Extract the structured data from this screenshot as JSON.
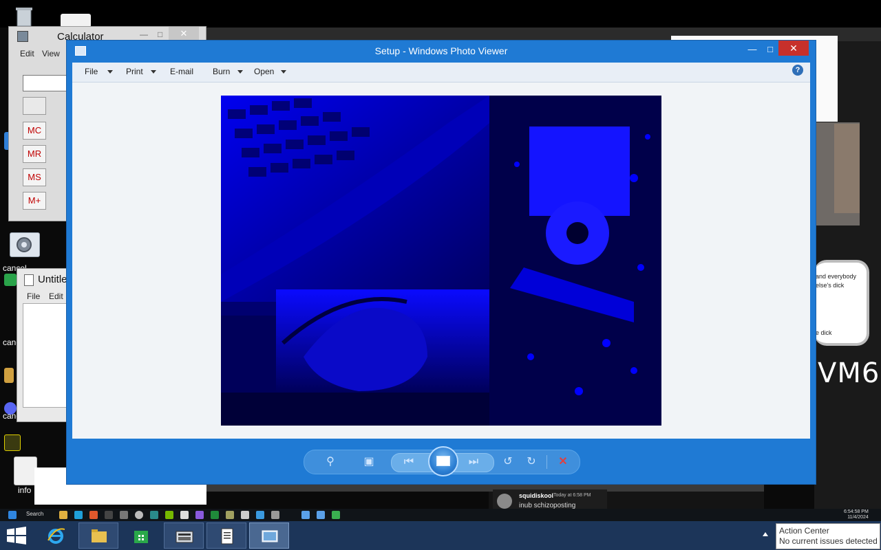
{
  "desktop": {
    "icon_labels": [
      "cancel",
      "cancel",
      "cancel",
      "cancel",
      "cancel",
      "info"
    ],
    "note": {
      "line1": "and everybody",
      "line2": "else's dick",
      "line3": "e dick"
    },
    "scribble": "VM6"
  },
  "calculator": {
    "title": "Calculator",
    "menu": [
      "Edit",
      "View"
    ],
    "memory_buttons": [
      "MC",
      "MR",
      "MS",
      "M+"
    ]
  },
  "notepad": {
    "title": "Untitle",
    "menu": [
      "File",
      "Edit"
    ]
  },
  "photo_viewer": {
    "title": "Setup - Windows Photo Viewer",
    "toolbar": [
      {
        "label": "File",
        "has_menu": true
      },
      {
        "label": "Print",
        "has_menu": true
      },
      {
        "label": "E-mail",
        "has_menu": false
      },
      {
        "label": "Burn",
        "has_menu": true
      },
      {
        "label": "Open",
        "has_menu": true
      }
    ],
    "help_label": "?",
    "controls": {
      "zoom": "zoom-icon",
      "fit": "fit-window-icon",
      "previous": "previous-icon",
      "slideshow": "slideshow-icon",
      "next": "next-icon",
      "rotate_ccw": "rotate-ccw-icon",
      "rotate_cw": "rotate-cw-icon",
      "delete": "delete-icon"
    },
    "accent": "#1f7ad4",
    "image_tint": "#0000ff"
  },
  "notification": {
    "name": "squidiskool",
    "meta": "Today at 6:58 PM",
    "message": "inub schizoposting"
  },
  "inner_taskbar": {
    "search": "Search",
    "clock_time": "6:54:58 PM",
    "clock_date": "11/4/2024"
  },
  "taskbar": {
    "apps": [
      "start",
      "internet-explorer",
      "file-explorer",
      "store",
      "calculator",
      "notepad",
      "photo-viewer"
    ],
    "action_center": {
      "title": "Action Center",
      "status": "No current issues detected"
    }
  }
}
